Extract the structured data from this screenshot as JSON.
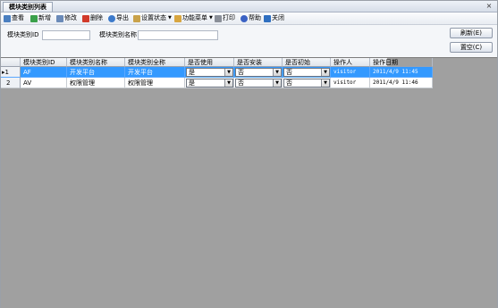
{
  "tab": {
    "title": "模块类别列表",
    "close": "×"
  },
  "toolbar": {
    "view": "查看",
    "add": "新增",
    "edit": "修改",
    "delete": "删除",
    "export": "导出",
    "set_status": "设置状态",
    "function_menu": "功能菜单",
    "print": "打印",
    "help": "帮助",
    "close": "关闭"
  },
  "filter": {
    "id_label": "模块类别ID",
    "id_value": "",
    "name_label": "模块类别名称",
    "name_value": "",
    "refresh_button": "刷新(E)",
    "reset_button": "置空(C)"
  },
  "grid": {
    "columns": [
      "模块类别ID",
      "模块类别名称",
      "模块类别全称",
      "是否使用",
      "是否安装",
      "是否初始",
      "操作人",
      "操作日期"
    ],
    "rows": [
      {
        "indicator": "▸1",
        "id": "AF",
        "name": "开发平台",
        "fullname": "开发平台",
        "use": "是",
        "install": "否",
        "init": "否",
        "operator": "visitor",
        "date": "2011/4/9 11:45"
      },
      {
        "indicator": "2",
        "id": "AV",
        "name": "权限管理",
        "fullname": "权限管理",
        "use": "是",
        "install": "否",
        "init": "否",
        "operator": "visitor",
        "date": "2011/4/9 11:46"
      }
    ]
  },
  "colors": {
    "selection": "#3399ff",
    "grid_background": "#a0a0a0"
  }
}
